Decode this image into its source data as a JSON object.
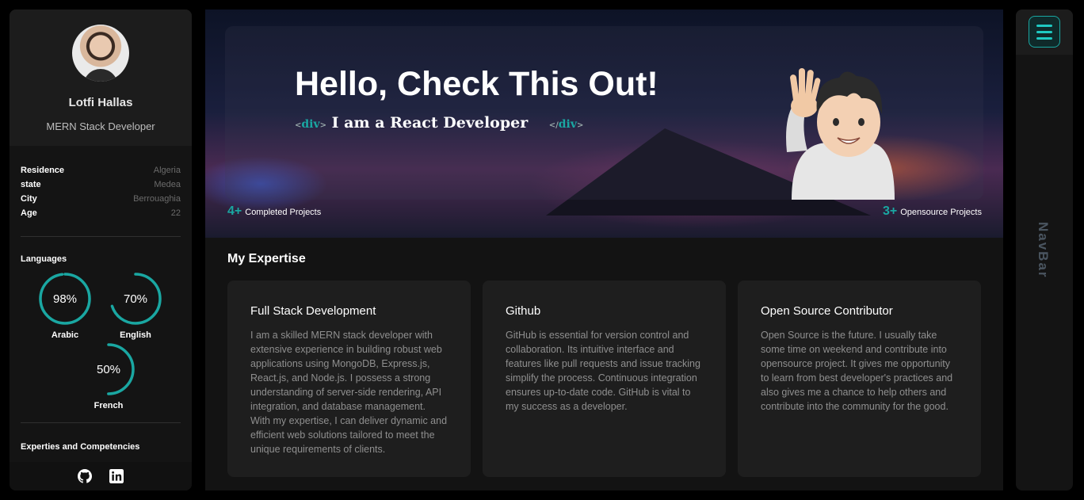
{
  "profile": {
    "name": "Lotfi Hallas",
    "role": "MERN Stack Developer"
  },
  "info": [
    {
      "key": "Residence",
      "value": "Algeria"
    },
    {
      "key": "state",
      "value": "Medea"
    },
    {
      "key": "City",
      "value": "Berrouaghia"
    },
    {
      "key": "Age",
      "value": "22"
    }
  ],
  "languages": {
    "title": "Languages",
    "items": [
      {
        "label": "Arabic",
        "percent_text": "98%",
        "percent": 98
      },
      {
        "label": "English",
        "percent_text": "70%",
        "percent": 70
      },
      {
        "label": "French",
        "percent_text": "50%",
        "percent": 50
      }
    ]
  },
  "competencies_title": "Experties and Competencies",
  "socials": [
    "github-icon",
    "linkedin-icon"
  ],
  "hero": {
    "title": "Hello, Check This Out!",
    "tag_open": "div",
    "tag_close": "div",
    "subtitle": "I am a React Developer",
    "stats": [
      {
        "num": "4+",
        "label": "Completed Projects"
      },
      {
        "num": "3+",
        "label": "Opensource Projects"
      }
    ]
  },
  "expertise": {
    "title": "My Expertise",
    "cards": [
      {
        "title": "Full Stack Development",
        "text": "I am a skilled MERN stack developer with extensive experience in building robust web applications using MongoDB, Express.js, React.js, and Node.js. I possess a strong understanding of server-side rendering, API integration, and database management. With my expertise, I can deliver dynamic and efficient web solutions tailored to meet the unique requirements of clients."
      },
      {
        "title": "Github",
        "text": "GitHub is essential for version control and collaboration. Its intuitive interface and features like pull requests and issue tracking simplify the process. Continuous integration ensures up-to-date code. GitHub is vital to my success as a developer."
      },
      {
        "title": "Open Source Contributor",
        "text": "Open Source is the future. I usually take some time on weekend and contribute into opensource project. It gives me opportunity to learn from best developer's practices and also gives me a chance to help others and contribute into the community for the good."
      }
    ]
  },
  "nav": {
    "label": "NavBar"
  },
  "colors": {
    "accent": "#1aa7a2",
    "background": "#000000",
    "panel": "#141414"
  }
}
